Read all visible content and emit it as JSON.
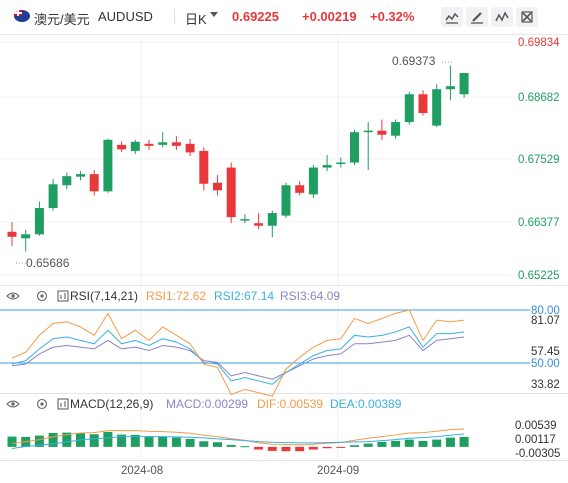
{
  "header": {
    "symbol_name": "澳元/美元",
    "symbol_code": "AUDUSD",
    "period": "日K",
    "price": "0.69225",
    "change": "+0.00219",
    "change_pct": "+0.32%",
    "toolbar_icons": [
      "chart-type-icon",
      "draw-icon",
      "indicator-icon",
      "settings-icon"
    ]
  },
  "colors": {
    "up": "#1f9e61",
    "down": "#e8383c",
    "rsi1": "#f59a4a",
    "rsi2": "#3ab0e2",
    "rsi3": "#8b84c9",
    "macd_label": "#8b84c9",
    "dif": "#f59a4a",
    "dea": "#3ab0e2"
  },
  "main_chart": {
    "axis_labels": [
      "0.69834",
      "0.68682",
      "0.67529",
      "0.66377",
      "0.65225"
    ],
    "high_label": "0.69373",
    "low_label": "0.65686"
  },
  "rsi": {
    "title": "RSI(7,14,21)",
    "rsi1": "RSI1:72.62",
    "rsi2": "RSI2:67.14",
    "rsi3": "RSI3:64.09",
    "axis_labels": [
      "80.00",
      "81.07",
      "57.45",
      "50.00",
      "33.82"
    ]
  },
  "macd": {
    "title": "MACD(12,26,9)",
    "macd": "MACD:0.00299",
    "dif": "DIF:0.00539",
    "dea": "DEA:0.00389",
    "axis_labels": [
      "0.00539",
      "0.00117",
      "-0.00305"
    ]
  },
  "x_axis": {
    "labels": [
      "2024-08",
      "2024-09"
    ]
  },
  "chart_data": {
    "type": "candlestick",
    "ylim": [
      0.6495,
      0.6995
    ],
    "candles": [
      {
        "o": 0.6608,
        "h": 0.6627,
        "l": 0.658,
        "c": 0.6598
      },
      {
        "o": 0.6595,
        "h": 0.6612,
        "l": 0.6569,
        "c": 0.6603
      },
      {
        "o": 0.6603,
        "h": 0.6668,
        "l": 0.66,
        "c": 0.6655
      },
      {
        "o": 0.6655,
        "h": 0.6712,
        "l": 0.665,
        "c": 0.6702
      },
      {
        "o": 0.67,
        "h": 0.6725,
        "l": 0.6692,
        "c": 0.6718
      },
      {
        "o": 0.6717,
        "h": 0.6728,
        "l": 0.671,
        "c": 0.6722
      },
      {
        "o": 0.6722,
        "h": 0.673,
        "l": 0.668,
        "c": 0.6688
      },
      {
        "o": 0.6688,
        "h": 0.6792,
        "l": 0.6685,
        "c": 0.679
      },
      {
        "o": 0.678,
        "h": 0.6787,
        "l": 0.6766,
        "c": 0.6771
      },
      {
        "o": 0.6768,
        "h": 0.679,
        "l": 0.6762,
        "c": 0.6786
      },
      {
        "o": 0.6782,
        "h": 0.679,
        "l": 0.677,
        "c": 0.6778
      },
      {
        "o": 0.678,
        "h": 0.6805,
        "l": 0.6775,
        "c": 0.6785
      },
      {
        "o": 0.6785,
        "h": 0.6797,
        "l": 0.677,
        "c": 0.6778
      },
      {
        "o": 0.6782,
        "h": 0.6792,
        "l": 0.6758,
        "c": 0.6765
      },
      {
        "o": 0.6768,
        "h": 0.6775,
        "l": 0.669,
        "c": 0.6703
      },
      {
        "o": 0.6705,
        "h": 0.672,
        "l": 0.668,
        "c": 0.669
      },
      {
        "o": 0.6735,
        "h": 0.6745,
        "l": 0.6625,
        "c": 0.6637
      },
      {
        "o": 0.663,
        "h": 0.6643,
        "l": 0.6625,
        "c": 0.6633
      },
      {
        "o": 0.6625,
        "h": 0.6645,
        "l": 0.6613,
        "c": 0.662
      },
      {
        "o": 0.662,
        "h": 0.665,
        "l": 0.6597,
        "c": 0.6645
      },
      {
        "o": 0.664,
        "h": 0.6705,
        "l": 0.6635,
        "c": 0.67
      },
      {
        "o": 0.67,
        "h": 0.6708,
        "l": 0.668,
        "c": 0.6685
      },
      {
        "o": 0.6682,
        "h": 0.674,
        "l": 0.6675,
        "c": 0.6735
      },
      {
        "o": 0.6735,
        "h": 0.676,
        "l": 0.6728,
        "c": 0.674
      },
      {
        "o": 0.6742,
        "h": 0.6755,
        "l": 0.6735,
        "c": 0.6745
      },
      {
        "o": 0.6745,
        "h": 0.681,
        "l": 0.674,
        "c": 0.6805
      },
      {
        "o": 0.6805,
        "h": 0.6825,
        "l": 0.673,
        "c": 0.6808
      },
      {
        "o": 0.6808,
        "h": 0.683,
        "l": 0.679,
        "c": 0.68
      },
      {
        "o": 0.6798,
        "h": 0.683,
        "l": 0.6792,
        "c": 0.6825
      },
      {
        "o": 0.6825,
        "h": 0.6885,
        "l": 0.682,
        "c": 0.688
      },
      {
        "o": 0.688,
        "h": 0.6888,
        "l": 0.6838,
        "c": 0.6843
      },
      {
        "o": 0.6818,
        "h": 0.69,
        "l": 0.6815,
        "c": 0.689
      },
      {
        "o": 0.689,
        "h": 0.6937,
        "l": 0.6868,
        "c": 0.6896
      },
      {
        "o": 0.688,
        "h": 0.6922,
        "l": 0.6873,
        "c": 0.6922
      }
    ],
    "rsi1": [
      51.5,
      55,
      65,
      72,
      73,
      70,
      65,
      78,
      63,
      68,
      62,
      70,
      65,
      60,
      48,
      46,
      30,
      33,
      31,
      29,
      45,
      52,
      58,
      62,
      63,
      75,
      72,
      75,
      78,
      80,
      62,
      74,
      73,
      74
    ],
    "rsi2": [
      48,
      50,
      57,
      63,
      64,
      62,
      60,
      68,
      60,
      62,
      59,
      63,
      61,
      57,
      49,
      48,
      38,
      40,
      38,
      36,
      43,
      48,
      53,
      56,
      57,
      65,
      64,
      65,
      67,
      70,
      58,
      66,
      66,
      67
    ],
    "rsi3": [
      47,
      48,
      54,
      58,
      59,
      58,
      57,
      62,
      57,
      58,
      56,
      59,
      58,
      56,
      50,
      49,
      41,
      43,
      41,
      39,
      43,
      47,
      51,
      53,
      54,
      60,
      60,
      61,
      62,
      65,
      56,
      62,
      63,
      64
    ],
    "macd": [
      0.0031,
      0.003,
      0.0034,
      0.0042,
      0.0043,
      0.0041,
      0.0038,
      0.0045,
      0.0037,
      0.0036,
      0.0032,
      0.0031,
      0.0028,
      0.0024,
      0.0017,
      0.0014,
      0.0006,
      0.0002,
      -0.0008,
      -0.0012,
      -0.0013,
      -0.0013,
      -0.0008,
      -0.0004,
      -0.0002,
      0.0005,
      0.001,
      0.0015,
      0.0018,
      0.0022,
      0.0018,
      0.0022,
      0.0028,
      0.003
    ],
    "dif": [
      0.001,
      0.0016,
      0.0022,
      0.003,
      0.0037,
      0.0042,
      0.0043,
      0.0049,
      0.0049,
      0.0049,
      0.0047,
      0.0046,
      0.0044,
      0.0041,
      0.0035,
      0.0031,
      0.0025,
      0.002,
      0.0012,
      0.0008,
      0.0007,
      0.0006,
      0.0008,
      0.0011,
      0.0013,
      0.002,
      0.0026,
      0.0031,
      0.0036,
      0.0042,
      0.0043,
      0.0047,
      0.0052,
      0.0054
    ],
    "dea": [
      -0.0005,
      0.0001,
      0.0005,
      0.0009,
      0.0015,
      0.0021,
      0.0024,
      0.0027,
      0.0031,
      0.0031,
      0.0031,
      0.0031,
      0.003,
      0.0029,
      0.0027,
      0.0024,
      0.0022,
      0.0019,
      0.0016,
      0.0014,
      0.0013,
      0.0012,
      0.0012,
      0.0013,
      0.0014,
      0.0015,
      0.0016,
      0.0019,
      0.0022,
      0.0026,
      0.0028,
      0.0031,
      0.0035,
      0.0039
    ],
    "rsi_ylim": [
      28,
      86
    ],
    "macd_ylim": [
      -0.0036,
      0.0066
    ]
  }
}
